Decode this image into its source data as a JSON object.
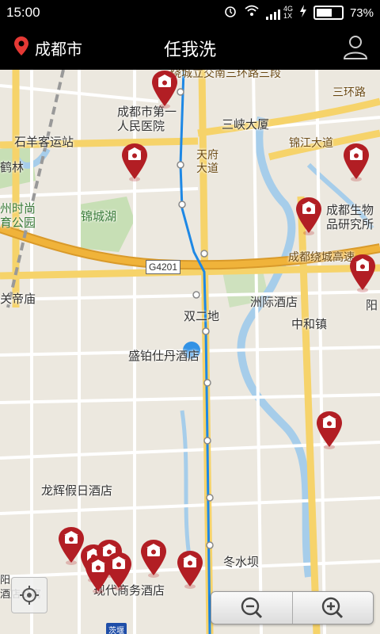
{
  "status_bar": {
    "time": "15:00",
    "network_label": "4G",
    "network_sub": "1X",
    "battery_percent": "73%",
    "battery_level": 0.73,
    "icons": [
      "alarm-icon",
      "wifi-icon",
      "signal-icon",
      "charging-icon"
    ]
  },
  "header": {
    "city": "成都市",
    "title": "任我洗",
    "colors": {
      "background": "#000000",
      "pin": "#e53935"
    }
  },
  "map": {
    "labels": {
      "hospital": "成都市第一\n人民医院",
      "sanxia": "三峡大厦",
      "bus_station": "石羊客运站",
      "jinjiang": "锦江大道",
      "tianfu": "天府\n大道",
      "jincheng_lake": "锦城湖",
      "time_park": "州时尚\n育公园",
      "bio_institute": "成都生物\n品研究所",
      "ring_road_top": "绕城立交南三环路三段",
      "third_ring": "三环路",
      "ring_highway": "成都绕城高速",
      "guandi": "关帝庙",
      "shuangerdi": "双二地",
      "zhouji_hotel": "洲际酒店",
      "zhonghe": "中和镇",
      "shengbo_hotel": "盛铂仕丹酒店",
      "longhui_hotel": "龙辉假日酒店",
      "dongshuiba": "冬水坝",
      "xiandai_hotel": "现代商务酒店",
      "yang": "阳",
      "he_lin": "鹤林",
      "fangong": "阳\n酒店公寓"
    },
    "highway_badge": "G4201",
    "metro_badge": "茨堰",
    "colors": {
      "background": "#ece8df",
      "main_road": "#f6d36a",
      "highway": "#f0b33a",
      "route": "#1e88e5",
      "river": "#a6cdea",
      "park": "#c7dfb5",
      "pin": "#b21e24"
    },
    "pins_count": 14
  },
  "controls": {
    "zoom_out": "−",
    "zoom_in": "+"
  }
}
